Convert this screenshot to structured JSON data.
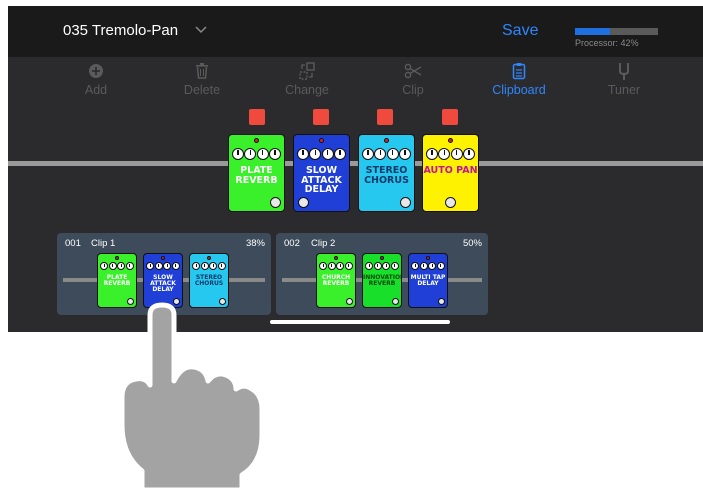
{
  "header": {
    "preset_title": "035 Tremolo-Pan",
    "save_label": "Save",
    "processor_label": "Processor: 42%",
    "processor_load": 0.42
  },
  "toolbar": {
    "items": [
      {
        "label": "Add",
        "icon": "plus-circle-icon",
        "active": false
      },
      {
        "label": "Delete",
        "icon": "trash-icon",
        "active": false
      },
      {
        "label": "Change",
        "icon": "swap-icon",
        "active": false
      },
      {
        "label": "Clip",
        "icon": "scissors-icon",
        "active": false
      },
      {
        "label": "Clipboard",
        "icon": "clipboard-icon",
        "active": true
      },
      {
        "label": "Tuner",
        "icon": "tuning-fork-icon",
        "active": false
      }
    ]
  },
  "chain": {
    "pedals": [
      {
        "name": "PLATE\nREVERB",
        "color": "#39f02a",
        "text_color": "#ffffff",
        "enabled": true
      },
      {
        "name": "SLOW ATTACK\nDELAY",
        "color": "#1f3fd6",
        "text_color": "#ffffff",
        "enabled": true
      },
      {
        "name": "STEREO\nCHORUS",
        "color": "#27c8f0",
        "text_color": "#0a3a6a",
        "enabled": true
      },
      {
        "name": "AUTO PAN",
        "color": "#fff200",
        "text_color": "#c0149a",
        "enabled": true
      }
    ]
  },
  "clips": [
    {
      "number": "001",
      "name": "Clip 1",
      "percent": "38%",
      "pedals": [
        {
          "name": "PLATE\nREVERB",
          "color": "#39f02a",
          "text_color": "#ffffff"
        },
        {
          "name": "SLOW ATTACK\nDELAY",
          "color": "#1f3fd6",
          "text_color": "#ffffff"
        },
        {
          "name": "STEREO\nCHORUS",
          "color": "#27c8f0",
          "text_color": "#0a3a6a"
        }
      ]
    },
    {
      "number": "002",
      "name": "Clip 2",
      "percent": "50%",
      "pedals": [
        {
          "name": "CHURCH\nREVERB",
          "color": "#39f02a",
          "text_color": "#ffffff"
        },
        {
          "name": "INNOVATION\nREVERB",
          "color": "#18e02a",
          "text_color": "#0a4a0a"
        },
        {
          "name": "MULTI TAP DELAY",
          "color": "#1f3fd6",
          "text_color": "#ffffff"
        }
      ]
    }
  ],
  "colors": {
    "accent": "#2f86ff",
    "toggle_on": "#f04a3f",
    "background": "#2b2b2d",
    "topbar": "#1a1a1a"
  }
}
